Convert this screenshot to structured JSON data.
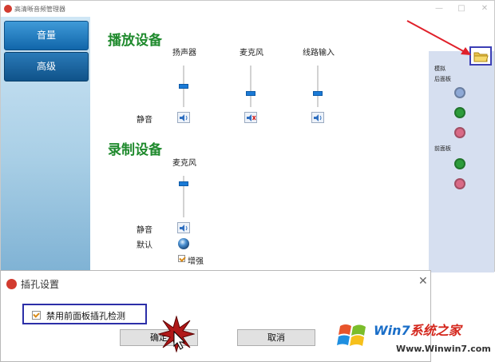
{
  "window": {
    "title": "高清晰音频管理器",
    "minimize": "—",
    "maximize": "□",
    "close": "✕"
  },
  "nav": {
    "volume": "音量",
    "advanced": "高级"
  },
  "playback": {
    "title": "播放设备",
    "columns": [
      "扬声器",
      "麦克风",
      "线路输入"
    ],
    "levels": [
      0.5,
      0.3,
      0.3
    ],
    "muted": [
      false,
      true,
      false
    ],
    "mute_label": "静音"
  },
  "recording": {
    "title": "录制设备",
    "column": "麦克风",
    "level": 0.85,
    "mute_label": "静音",
    "default_label": "默认",
    "boost_label": "增强",
    "boost_checked": true
  },
  "jack_panel": {
    "simulated_label": "模拟",
    "rear_label": "后面板",
    "front_label": "前面板",
    "rear_jacks": [
      "#8ea9d6",
      "#2d9c3b",
      "#d96a86"
    ],
    "front_jacks": [
      "#2d9c3b",
      "#d96a86"
    ],
    "folder_icon": "folder-icon"
  },
  "dialog": {
    "title": "插孔设置",
    "close": "✕",
    "checkbox_label": "禁用前面板插孔检测",
    "checkbox_checked": true,
    "ok_label": "确定",
    "cancel_label": "取消"
  },
  "watermark": {
    "brand_a": "Win7",
    "brand_b": "系统之家",
    "url": "Www.Winwin7.com"
  },
  "colors": {
    "accent_green": "#1f8a2d",
    "nav_blue": "#1166aa",
    "highlight": "#2c2fa8",
    "arrow_red": "#e0202a"
  }
}
